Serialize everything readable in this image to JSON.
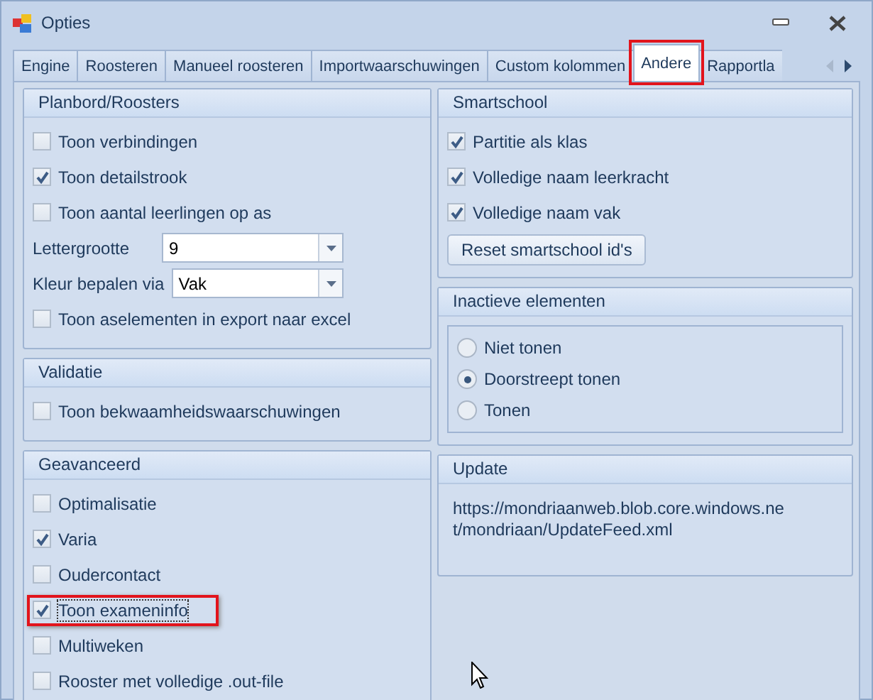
{
  "window": {
    "title": "Opties"
  },
  "tabs": [
    {
      "label": "Engine",
      "selected": false,
      "highlighted": false
    },
    {
      "label": "Roosteren",
      "selected": false,
      "highlighted": false
    },
    {
      "label": "Manueel roosteren",
      "selected": false,
      "highlighted": false
    },
    {
      "label": "Importwaarschuwingen",
      "selected": false,
      "highlighted": false
    },
    {
      "label": "Custom kolommen",
      "selected": false,
      "highlighted": false
    },
    {
      "label": "Andere",
      "selected": true,
      "highlighted": true
    },
    {
      "label": "Rapportla",
      "selected": false,
      "highlighted": false
    }
  ],
  "tab_scroll": {
    "left_disabled": true,
    "right_disabled": false
  },
  "left_groups": [
    {
      "title": "Planbord/Roosters",
      "items": [
        {
          "kind": "checkbox",
          "label": "Toon verbindingen",
          "checked": false,
          "highlighted": false
        },
        {
          "kind": "checkbox",
          "label": "Toon detailstrook",
          "checked": true,
          "highlighted": false
        },
        {
          "kind": "checkbox",
          "label": "Toon aantal leerlingen op as",
          "checked": false,
          "highlighted": false
        },
        {
          "kind": "dropdown",
          "label": "Lettergrootte",
          "value": "9"
        },
        {
          "kind": "dropdown",
          "label": "Kleur bepalen via",
          "value": "Vak"
        },
        {
          "kind": "checkbox",
          "label": "Toon aselementen in export naar excel",
          "checked": false,
          "highlighted": false
        }
      ]
    },
    {
      "title": "Validatie",
      "items": [
        {
          "kind": "checkbox",
          "label": "Toon bekwaamheidswaarschuwingen",
          "checked": false,
          "highlighted": false
        }
      ]
    },
    {
      "title": "Geavanceerd",
      "items": [
        {
          "kind": "checkbox",
          "label": "Optimalisatie",
          "checked": false,
          "highlighted": false
        },
        {
          "kind": "checkbox",
          "label": "Varia",
          "checked": true,
          "highlighted": false
        },
        {
          "kind": "checkbox",
          "label": "Oudercontact",
          "checked": false,
          "highlighted": false
        },
        {
          "kind": "checkbox",
          "label": "Toon exameninfo",
          "checked": true,
          "highlighted": true
        },
        {
          "kind": "checkbox",
          "label": "Multiweken",
          "checked": false,
          "highlighted": false
        },
        {
          "kind": "checkbox",
          "label": "Rooster met volledige .out-file",
          "checked": false,
          "highlighted": false
        }
      ]
    }
  ],
  "right_groups": [
    {
      "title": "Smartschool",
      "items": [
        {
          "kind": "checkbox",
          "label": "Partitie als klas",
          "checked": true,
          "highlighted": false
        },
        {
          "kind": "checkbox",
          "label": "Volledige naam leerkracht",
          "checked": true,
          "highlighted": false
        },
        {
          "kind": "checkbox",
          "label": "Volledige naam vak",
          "checked": true,
          "highlighted": false
        },
        {
          "kind": "button",
          "label": "Reset smartschool id's"
        }
      ]
    },
    {
      "title": "Inactieve elementen",
      "items": [
        {
          "kind": "radio",
          "label": "Niet tonen",
          "selected": false
        },
        {
          "kind": "radio",
          "label": "Doorstreept tonen",
          "selected": true
        },
        {
          "kind": "radio",
          "label": "Tonen",
          "selected": false
        }
      ]
    },
    {
      "title": "Update",
      "items": [
        {
          "kind": "text",
          "label": "https://mondriaanweb.blob.core.windows.net/mondriaan/UpdateFeed.xml"
        }
      ]
    }
  ]
}
